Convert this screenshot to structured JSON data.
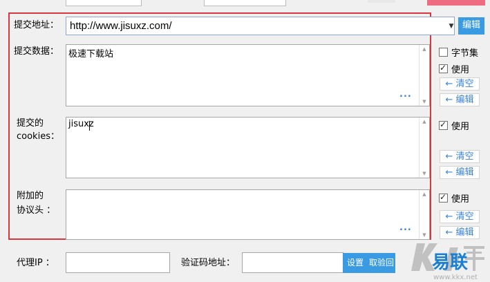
{
  "form": {
    "submit_url": {
      "label": "提交地址：",
      "value": "http://www.jisuxz.com/",
      "edit_button": "编辑"
    },
    "submit_data": {
      "label": "提交数据：",
      "value": "极速下载站",
      "more": "...",
      "charset_label": "字节集",
      "charset_checked": false,
      "use_label": "使用",
      "use_checked": true,
      "clear_label": "← 清空",
      "edit_label": "← 编辑"
    },
    "cookies": {
      "label_line1": "提交的",
      "label_line2": "cookies：",
      "value": "jisuxz",
      "use_label": "使用",
      "use_checked": true,
      "clear_label": "← 清空",
      "edit_label": "← 编辑"
    },
    "headers": {
      "label_line1": "附加的",
      "label_line2": "协议头 ：",
      "value": "",
      "more": "...",
      "use_label": "使用",
      "use_checked": true,
      "clear_label": "← 清空",
      "edit_label": "← 编辑"
    }
  },
  "footer": {
    "proxy_label": "代理IP ：",
    "proxy_value": "",
    "captcha_label": "验证码地址：",
    "captcha_value": "",
    "set_button": "设置",
    "cancel_button": "取验回"
  },
  "watermark": {
    "brand": "易联",
    "site": "www.kkx.net",
    "accent": "#1a7fd3"
  },
  "colors": {
    "accent": "#3a9be3",
    "frame": "#d9373f",
    "link": "#3a82d8"
  }
}
